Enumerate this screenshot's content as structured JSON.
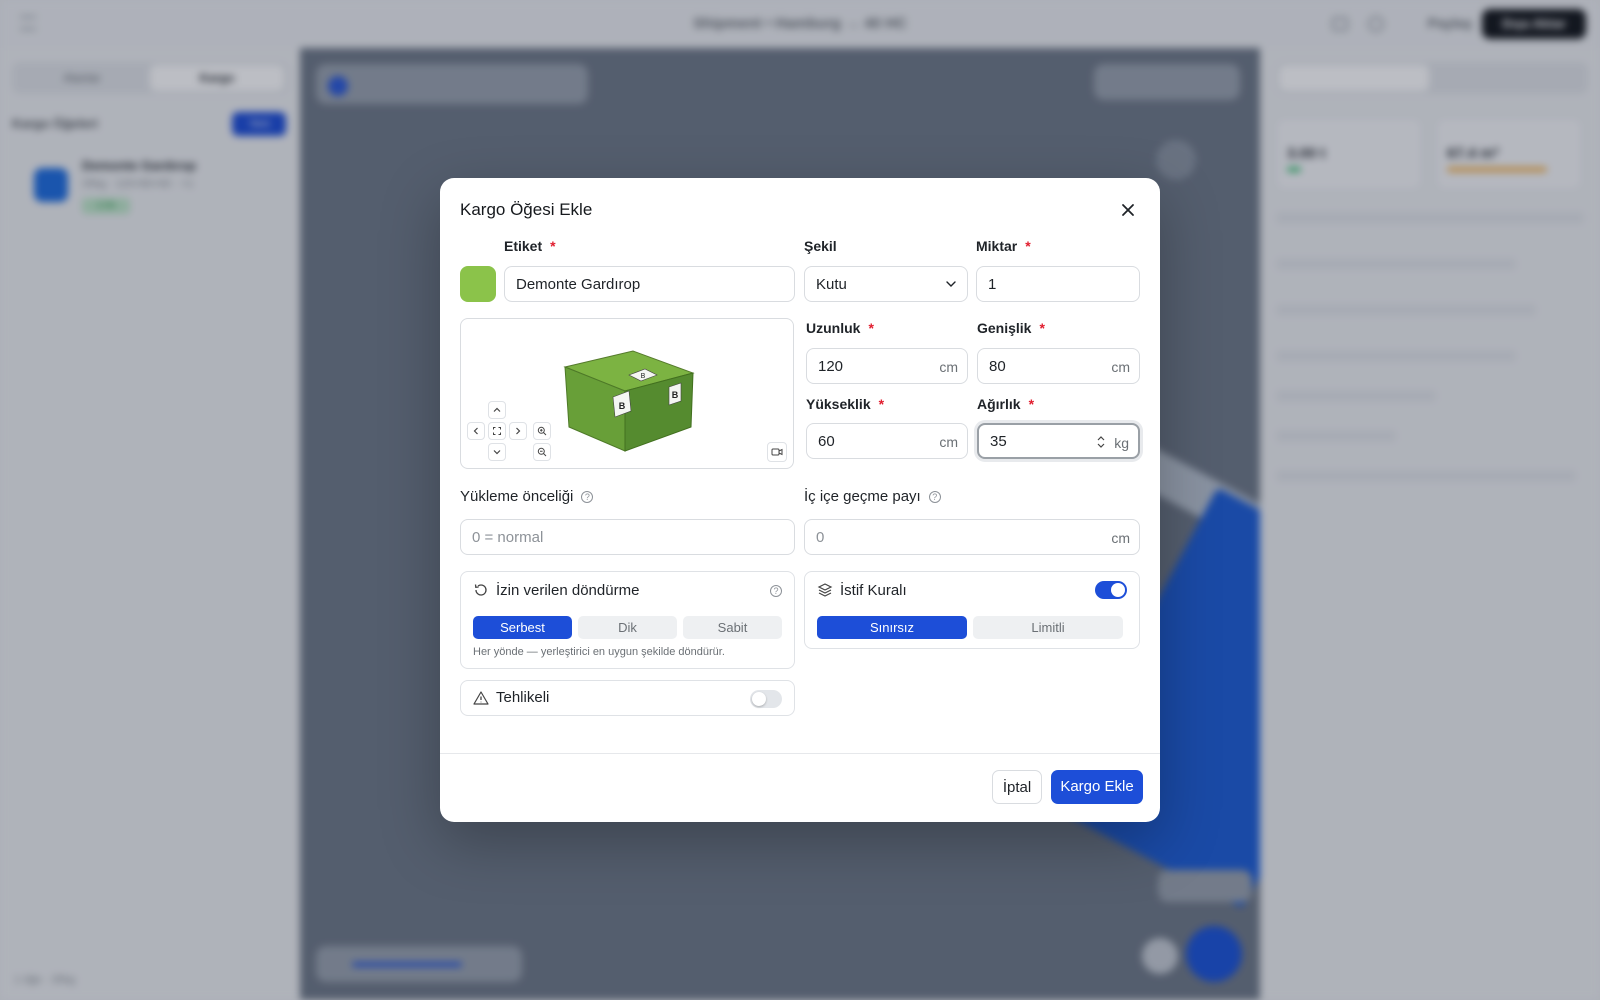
{
  "modal": {
    "title": "Kargo Öğesi Ekle",
    "label_field": {
      "label": "Etiket",
      "value": "Demonte Gardırop",
      "color": "#8bc34a"
    },
    "shape_field": {
      "label": "Şekil",
      "value": "Kutu"
    },
    "quantity_field": {
      "label": "Miktar",
      "value": "1"
    },
    "length_field": {
      "label": "Uzunluk",
      "value": "120",
      "unit": "cm"
    },
    "width_field": {
      "label": "Genişlik",
      "value": "80",
      "unit": "cm"
    },
    "height_field": {
      "label": "Yükseklik",
      "value": "60",
      "unit": "cm"
    },
    "weight_field": {
      "label": "Ağırlık",
      "value": "35",
      "unit": "kg"
    },
    "priority_field": {
      "label": "Yükleme önceliği",
      "placeholder": "0 = normal"
    },
    "nesting_field": {
      "label": "İç içe geçme payı",
      "placeholder": "0",
      "unit": "cm"
    },
    "preview": {
      "box_labels": [
        "B",
        "B",
        "B"
      ]
    },
    "rotation": {
      "title": "İzin verilen döndürme",
      "options": [
        "Serbest",
        "Dik",
        "Sabit"
      ],
      "selected": "Serbest",
      "hint": "Her yönde — yerleştirici en uygun şekilde döndürür."
    },
    "stacking": {
      "title": "İstif Kuralı",
      "enabled": true,
      "options": [
        "Sınırsız",
        "Limitli"
      ],
      "selected": "Sınırsız"
    },
    "hazardous": {
      "title": "Tehlikeli",
      "enabled": false
    },
    "buttons": {
      "cancel": "İptal",
      "submit": "Kargo Ekle"
    },
    "required_mark": "*"
  },
  "colors": {
    "accent": "#1d4ed8",
    "required": "#e11d2e",
    "swatch": "#8bc34a"
  },
  "background": {
    "note": "blurred application behind modal",
    "header_title": "Shipment • Hamburg → 40 HC",
    "share_label": "Paylaş",
    "export_label": "Dışa Aktar",
    "left_tabs": [
      "Alanlar",
      "Kargo"
    ],
    "left_header": "Kargo Öğeleri",
    "left_new_button": "Yeni",
    "left_item": {
      "name": "Demonte Gardırop",
      "meta": "35kg · 120×80×60 · ×1",
      "badge": "1.0x"
    },
    "left_footer": "1 öğe · 35kg",
    "right_stat_1": "3.00 t",
    "right_stat_2": "67.4 m³"
  }
}
